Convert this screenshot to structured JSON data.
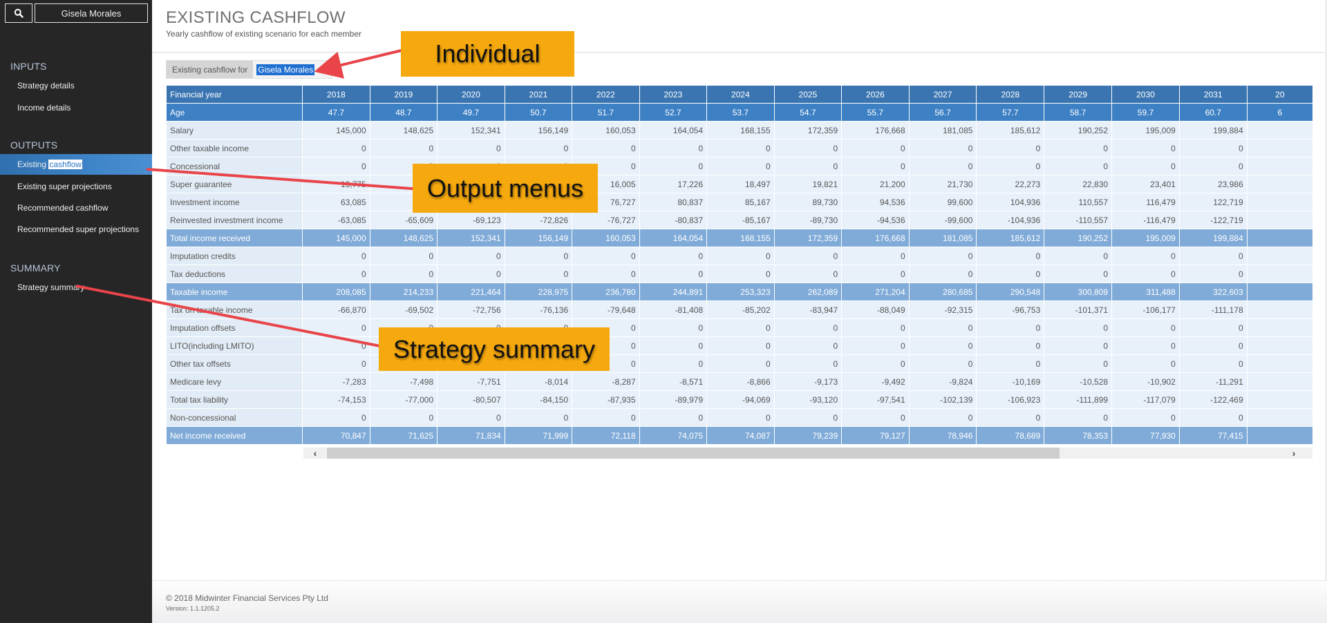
{
  "sidebar": {
    "search_icon": "search-icon",
    "user_name": "Gisela Morales",
    "sections": [
      {
        "title": "INPUTS",
        "items": [
          {
            "label": "Strategy details"
          },
          {
            "label": "Income details"
          }
        ]
      },
      {
        "title": "OUTPUTS",
        "items": [
          {
            "label_prefix": "Existing ",
            "label_highlight": "cashflow",
            "active": true
          },
          {
            "label": "Existing super projections"
          },
          {
            "label": "Recommended cashflow"
          },
          {
            "label": "Recommended super projections"
          }
        ]
      },
      {
        "title": "SUMMARY",
        "items": [
          {
            "label": "Strategy summary"
          }
        ]
      }
    ]
  },
  "header": {
    "title": "EXISTING CASHFLOW",
    "subtitle": "Yearly cashflow of existing scenario for each member"
  },
  "selector": {
    "label": "Existing cashflow for",
    "value": "Gisela Morales",
    "caret_icon": "caret-down-icon"
  },
  "table": {
    "header_label": "Financial year",
    "years": [
      "2018",
      "2019",
      "2020",
      "2021",
      "2022",
      "2023",
      "2024",
      "2025",
      "2026",
      "2027",
      "2028",
      "2029",
      "2030",
      "2031",
      "20"
    ],
    "age_label": "Age",
    "ages": [
      "47.7",
      "48.7",
      "49.7",
      "50.7",
      "51.7",
      "52.7",
      "53.7",
      "54.7",
      "55.7",
      "56.7",
      "57.7",
      "58.7",
      "59.7",
      "60.7",
      "6"
    ],
    "rows": [
      {
        "label": "Salary",
        "type": "data",
        "values": [
          "145,000",
          "148,625",
          "152,341",
          "156,149",
          "160,053",
          "164,054",
          "168,155",
          "172,359",
          "176,668",
          "181,085",
          "185,612",
          "190,252",
          "195,009",
          "199,884",
          ""
        ]
      },
      {
        "label": "Other taxable income",
        "type": "data",
        "values": [
          "0",
          "0",
          "0",
          "0",
          "0",
          "0",
          "0",
          "0",
          "0",
          "0",
          "0",
          "0",
          "0",
          "0",
          ""
        ]
      },
      {
        "label": "Concessional",
        "type": "data",
        "values": [
          "0",
          "0",
          "0",
          "0",
          "0",
          "0",
          "0",
          "0",
          "0",
          "0",
          "0",
          "0",
          "0",
          "0",
          ""
        ]
      },
      {
        "label": "Super guarantee",
        "type": "data",
        "values": [
          "13,775",
          "",
          "",
          "",
          "16,005",
          "17,226",
          "18,497",
          "19,821",
          "21,200",
          "21,730",
          "22,273",
          "22,830",
          "23,401",
          "23,986",
          ""
        ]
      },
      {
        "label": "Investment income",
        "type": "data",
        "values": [
          "63,085",
          "",
          "",
          "",
          "76,727",
          "80,837",
          "85,167",
          "89,730",
          "94,536",
          "99,600",
          "104,936",
          "110,557",
          "116,479",
          "122,719",
          ""
        ]
      },
      {
        "label": "Reinvested investment income",
        "type": "data",
        "values": [
          "-63,085",
          "-65,609",
          "-69,123",
          "-72,826",
          "-76,727",
          "-80,837",
          "-85,167",
          "-89,730",
          "-94,536",
          "-99,600",
          "-104,936",
          "-110,557",
          "-116,479",
          "-122,719",
          ""
        ]
      },
      {
        "label": "Total income received",
        "type": "total",
        "values": [
          "145,000",
          "148,625",
          "152,341",
          "156,149",
          "160,053",
          "164,054",
          "168,155",
          "172,359",
          "176,668",
          "181,085",
          "185,612",
          "190,252",
          "195,009",
          "199,884",
          ""
        ]
      },
      {
        "label": "Imputation credits",
        "type": "data",
        "values": [
          "0",
          "0",
          "0",
          "0",
          "0",
          "0",
          "0",
          "0",
          "0",
          "0",
          "0",
          "0",
          "0",
          "0",
          ""
        ]
      },
      {
        "label": "Tax deductions",
        "type": "data",
        "values": [
          "0",
          "0",
          "0",
          "0",
          "0",
          "0",
          "0",
          "0",
          "0",
          "0",
          "0",
          "0",
          "0",
          "0",
          ""
        ]
      },
      {
        "label": "Taxable income",
        "type": "total",
        "values": [
          "208,085",
          "214,233",
          "221,464",
          "228,975",
          "236,780",
          "244,891",
          "253,323",
          "262,089",
          "271,204",
          "280,685",
          "290,548",
          "300,809",
          "311,488",
          "322,603",
          ""
        ]
      },
      {
        "label": "Tax on taxable income",
        "type": "data",
        "values": [
          "-66,870",
          "-69,502",
          "-72,756",
          "-76,136",
          "-79,648",
          "-81,408",
          "-85,202",
          "-83,947",
          "-88,049",
          "-92,315",
          "-96,753",
          "-101,371",
          "-106,177",
          "-111,178",
          ""
        ]
      },
      {
        "label": "Imputation offsets",
        "type": "data",
        "values": [
          "0",
          "0",
          "0",
          "0",
          "0",
          "0",
          "0",
          "0",
          "0",
          "0",
          "0",
          "0",
          "0",
          "0",
          ""
        ]
      },
      {
        "label": "LITO(including LMITO)",
        "type": "data",
        "values": [
          "0",
          "",
          "",
          "",
          "0",
          "0",
          "0",
          "0",
          "0",
          "0",
          "0",
          "0",
          "0",
          "0",
          ""
        ]
      },
      {
        "label": "Other tax offsets",
        "type": "data",
        "values": [
          "0",
          "",
          "",
          "",
          "0",
          "0",
          "0",
          "0",
          "0",
          "0",
          "0",
          "0",
          "0",
          "0",
          ""
        ]
      },
      {
        "label": "Medicare levy",
        "type": "data",
        "values": [
          "-7,283",
          "-7,498",
          "-7,751",
          "-8,014",
          "-8,287",
          "-8,571",
          "-8,866",
          "-9,173",
          "-9,492",
          "-9,824",
          "-10,169",
          "-10,528",
          "-10,902",
          "-11,291",
          ""
        ]
      },
      {
        "label": "Total tax liability",
        "type": "data",
        "values": [
          "-74,153",
          "-77,000",
          "-80,507",
          "-84,150",
          "-87,935",
          "-89,979",
          "-94,069",
          "-93,120",
          "-97,541",
          "-102,139",
          "-106,923",
          "-111,899",
          "-117,079",
          "-122,469",
          ""
        ]
      },
      {
        "label": "Non-concessional",
        "type": "data",
        "values": [
          "0",
          "0",
          "0",
          "0",
          "0",
          "0",
          "0",
          "0",
          "0",
          "0",
          "0",
          "0",
          "0",
          "0",
          ""
        ]
      },
      {
        "label": "Net income received",
        "type": "total",
        "values": [
          "70,847",
          "71,625",
          "71,834",
          "71,999",
          "72,118",
          "74,075",
          "74,087",
          "79,239",
          "79,127",
          "78,946",
          "78,689",
          "78,353",
          "77,930",
          "77,415",
          ""
        ]
      }
    ]
  },
  "scrollbar": {
    "left_icon": "chevron-left-icon",
    "right_icon": "chevron-right-icon",
    "left_glyph": "‹",
    "right_glyph": "›"
  },
  "footer": {
    "copyright": "© 2018 Midwinter Financial Services Pty Ltd",
    "version": "Version: 1.1.1205.2"
  },
  "annotations": {
    "individual": "Individual",
    "output_menus": "Output menus",
    "strategy_summary": "Strategy summary",
    "color": "#f6a90e",
    "arrow_color": "#e8444a"
  }
}
